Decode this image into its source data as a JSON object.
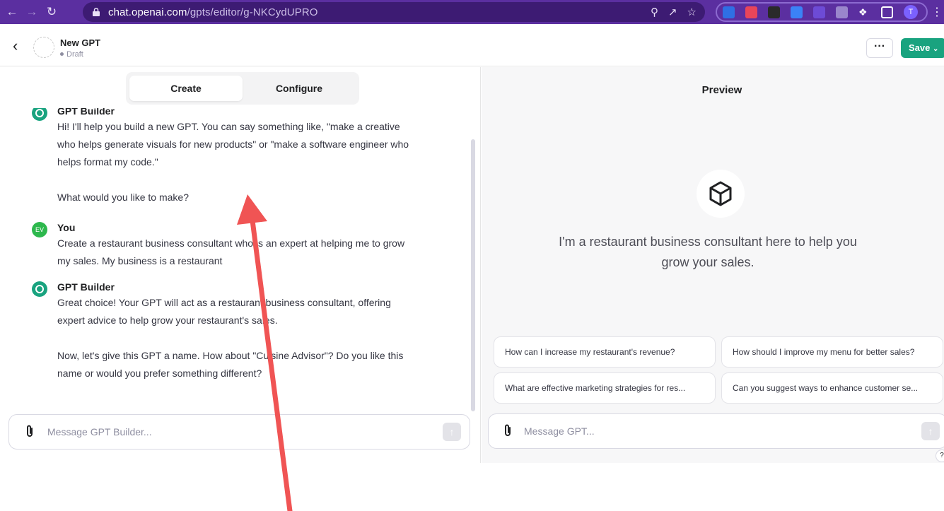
{
  "browser": {
    "url_host": "chat.openai.com",
    "url_path": "/gpts/editor/g-NKCydUPRO",
    "profile_initial": "T",
    "accent": "#5b2fa0"
  },
  "header": {
    "gpt_name": "New GPT",
    "status": "Draft",
    "more_label": "···",
    "save_label": "Save"
  },
  "builder": {
    "tabs": [
      {
        "label": "Create",
        "active": true
      },
      {
        "label": "Configure",
        "active": false
      }
    ],
    "messages": [
      {
        "author": "GPT Builder",
        "avatar": "openai-logo-icon",
        "paragraphs": [
          "Hi! I'll help you build a new GPT. You can say something like, \"make a creative who helps generate visuals for new products\" or \"make a software engineer who helps format my code.\"",
          "What would you like to make?"
        ]
      },
      {
        "author": "You",
        "avatar_initials": "EV",
        "paragraphs": [
          "Create a restaurant business consultant who is an expert at helping me to grow my sales. My business is a restaurant"
        ]
      },
      {
        "author": "GPT Builder",
        "avatar": "openai-logo-icon",
        "paragraphs": [
          "Great choice! Your GPT will act as a restaurant business consultant, offering expert advice to help grow your restaurant's sales.",
          "Now, let's give this GPT a name. How about \"Cuisine Advisor\"? Do you like this name or would you prefer something different?"
        ]
      }
    ],
    "composer_placeholder": "Message GPT Builder..."
  },
  "preview": {
    "title": "Preview",
    "tagline": "I'm a restaurant business consultant here to help you grow your sales.",
    "suggestions": [
      "How can I increase my restaurant's revenue?",
      "How should I improve my menu for better sales?",
      "What are effective marketing strategies for res...",
      "Can you suggest ways to enhance customer se..."
    ],
    "composer_placeholder": "Message GPT...",
    "help_label": "?"
  },
  "colors": {
    "save_green": "#19a37f",
    "annotation_arrow": "#f05454"
  }
}
